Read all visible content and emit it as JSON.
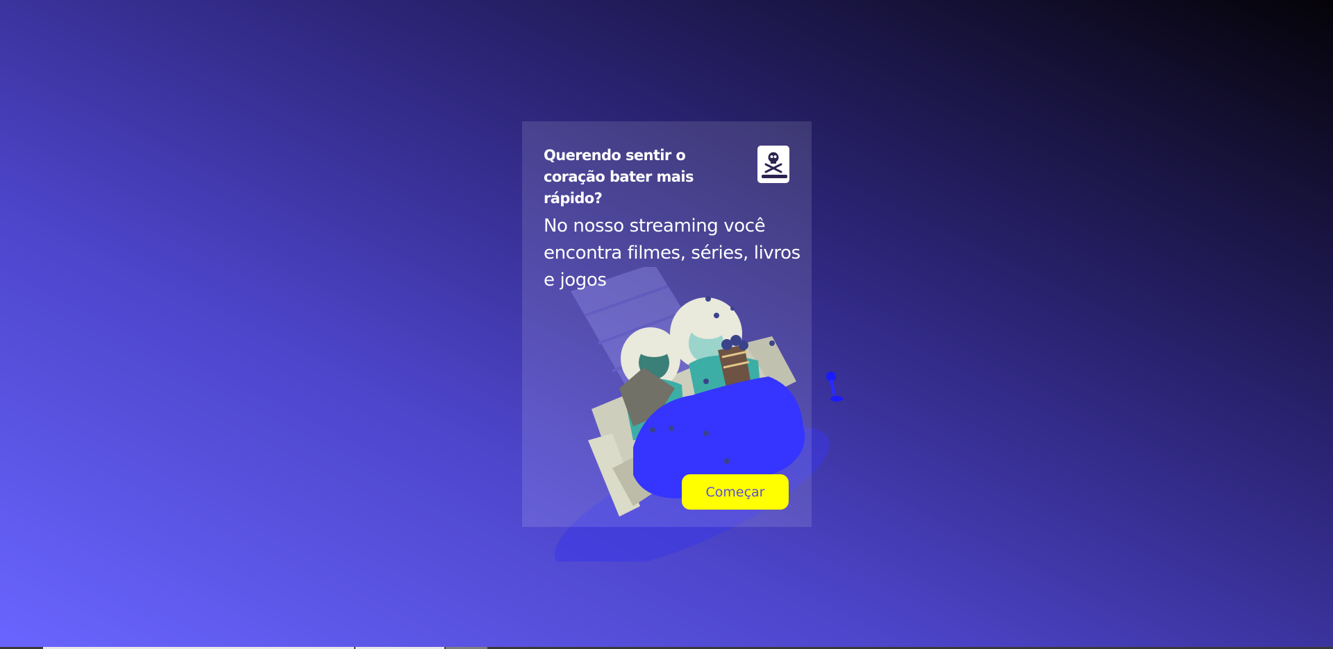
{
  "card": {
    "title": "Querendo sentir o coração bater mais rápido?",
    "description": "No nosso streaming você encontra filmes, séries, livros e jogos",
    "book_icon": "skull-book-icon",
    "cta_label": "Começar"
  },
  "illustration": {
    "name": "people-watching-on-couch-illustration"
  },
  "colors": {
    "background_start": "#6a65ff",
    "background_end": "#050308",
    "button": "#ffff00",
    "button_text": "#5b4fd9",
    "blanket": "#1a1aff",
    "text": "#ffffff"
  }
}
